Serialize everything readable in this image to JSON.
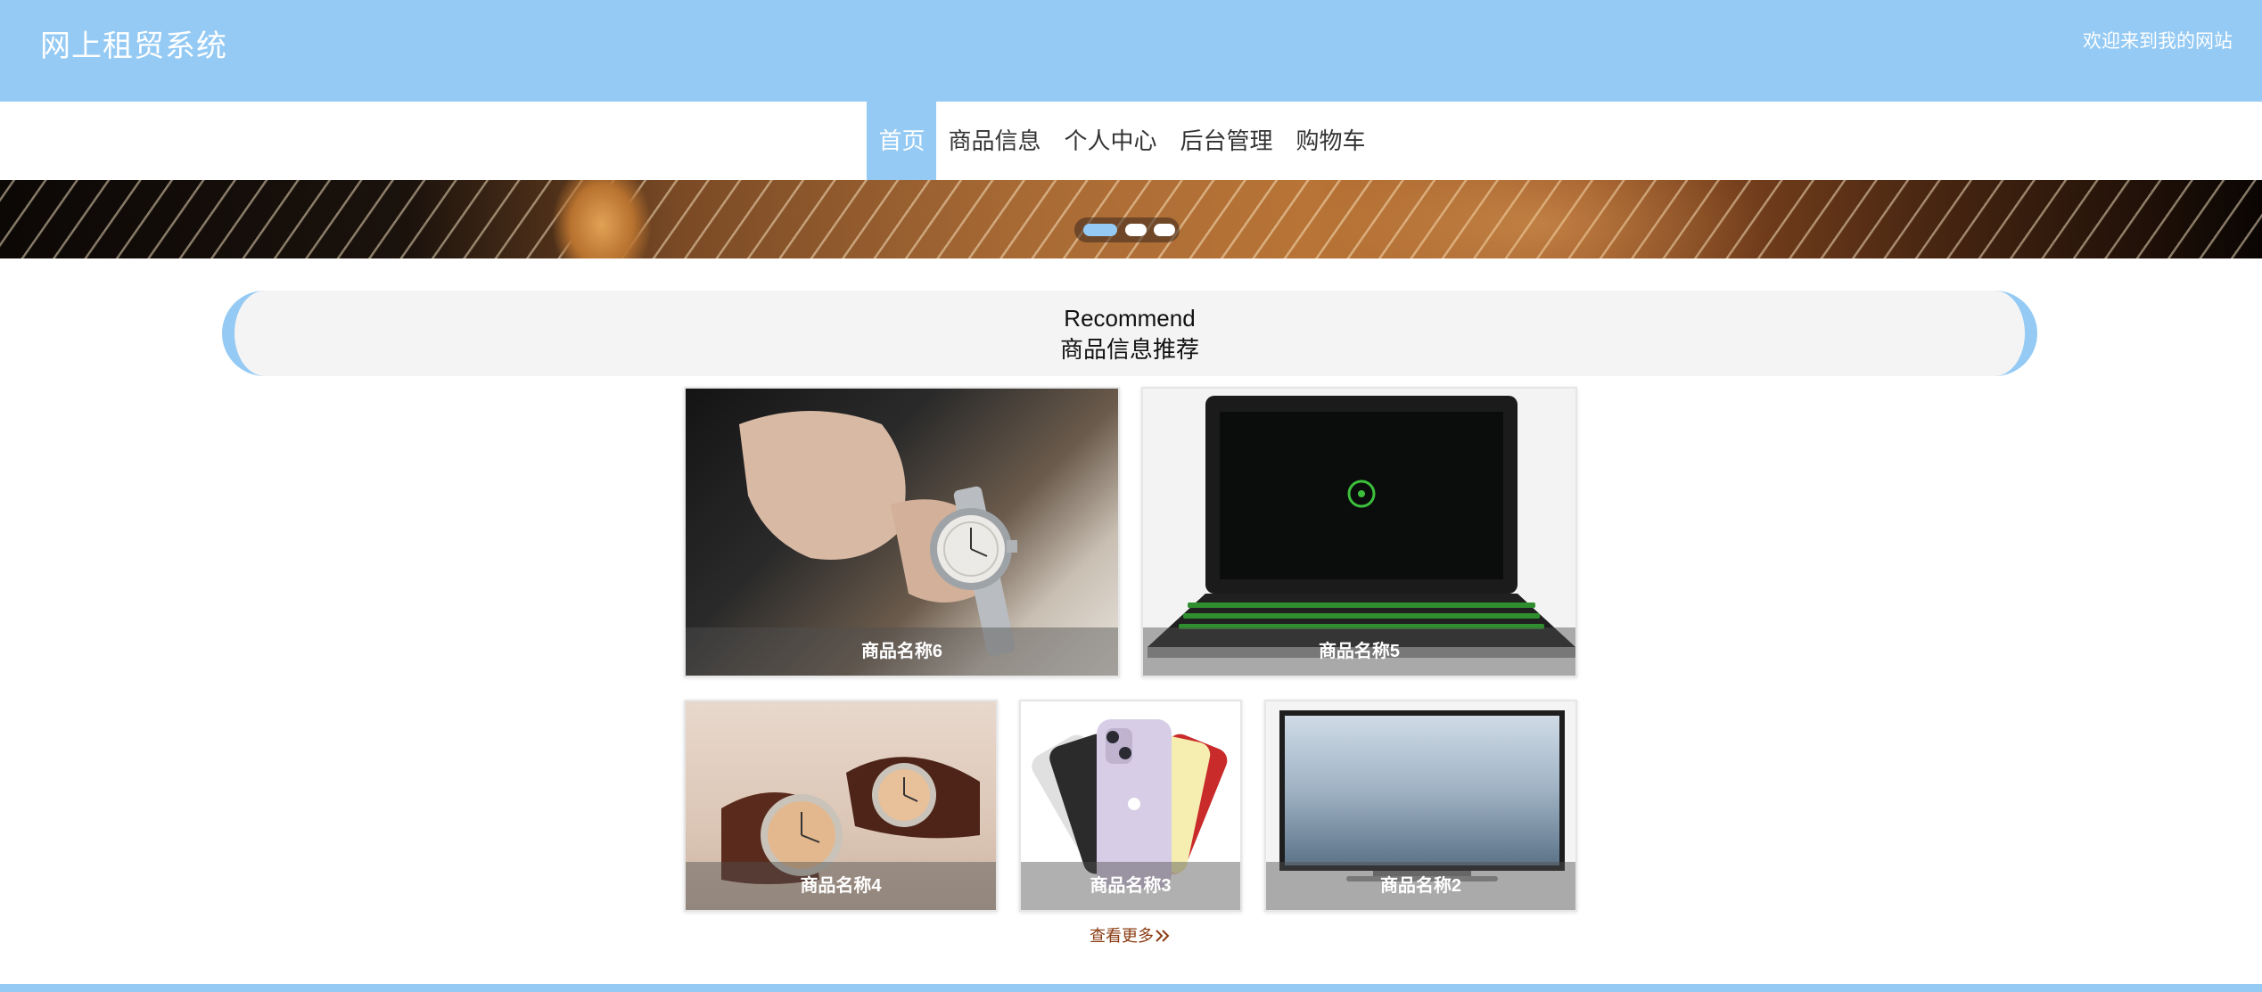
{
  "header": {
    "logo": "网上租贸系统",
    "welcome": "欢迎来到我的网站"
  },
  "nav": {
    "items": [
      {
        "label": "首页",
        "active": true
      },
      {
        "label": "商品信息"
      },
      {
        "label": "个人中心"
      },
      {
        "label": "后台管理"
      },
      {
        "label": "购物车"
      }
    ]
  },
  "banner": {
    "slides": 3,
    "active_slide": 1
  },
  "recommend": {
    "title_en": "Recommend",
    "title_cn": "商品信息推荐"
  },
  "products": [
    {
      "name": "商品名称6",
      "image": "wristwatch-on-wrist"
    },
    {
      "name": "商品名称5",
      "image": "gaming-laptop"
    },
    {
      "name": "商品名称4",
      "image": "pair-of-watches"
    },
    {
      "name": "商品名称3",
      "image": "smartphone"
    },
    {
      "name": "商品名称2",
      "image": "television"
    }
  ],
  "more_link": "查看更多",
  "colors": {
    "accent": "#94caf4",
    "more_link": "#8a3b12"
  }
}
